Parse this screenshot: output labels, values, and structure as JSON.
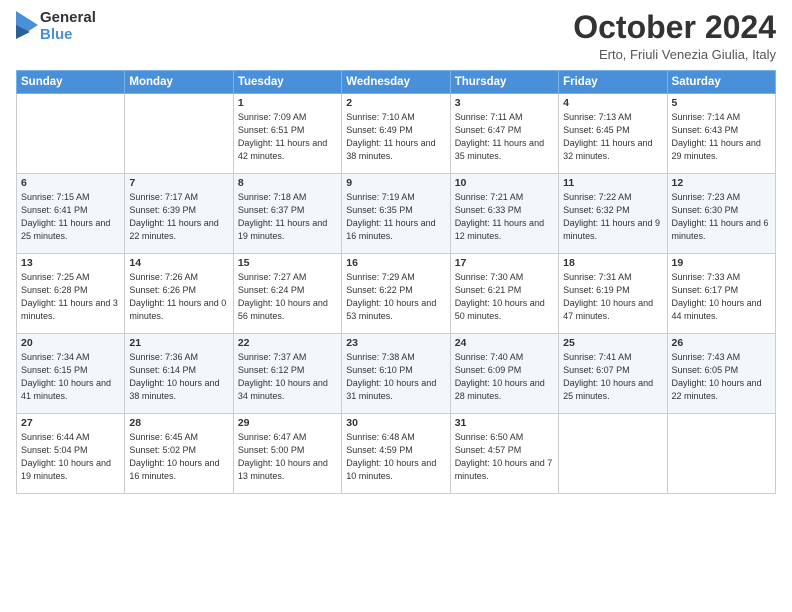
{
  "header": {
    "logo_general": "General",
    "logo_blue": "Blue",
    "month_title": "October 2024",
    "location": "Erto, Friuli Venezia Giulia, Italy"
  },
  "days_of_week": [
    "Sunday",
    "Monday",
    "Tuesday",
    "Wednesday",
    "Thursday",
    "Friday",
    "Saturday"
  ],
  "weeks": [
    [
      {
        "day": "",
        "sunrise": "",
        "sunset": "",
        "daylight": ""
      },
      {
        "day": "",
        "sunrise": "",
        "sunset": "",
        "daylight": ""
      },
      {
        "day": "1",
        "sunrise": "Sunrise: 7:09 AM",
        "sunset": "Sunset: 6:51 PM",
        "daylight": "Daylight: 11 hours and 42 minutes."
      },
      {
        "day": "2",
        "sunrise": "Sunrise: 7:10 AM",
        "sunset": "Sunset: 6:49 PM",
        "daylight": "Daylight: 11 hours and 38 minutes."
      },
      {
        "day": "3",
        "sunrise": "Sunrise: 7:11 AM",
        "sunset": "Sunset: 6:47 PM",
        "daylight": "Daylight: 11 hours and 35 minutes."
      },
      {
        "day": "4",
        "sunrise": "Sunrise: 7:13 AM",
        "sunset": "Sunset: 6:45 PM",
        "daylight": "Daylight: 11 hours and 32 minutes."
      },
      {
        "day": "5",
        "sunrise": "Sunrise: 7:14 AM",
        "sunset": "Sunset: 6:43 PM",
        "daylight": "Daylight: 11 hours and 29 minutes."
      }
    ],
    [
      {
        "day": "6",
        "sunrise": "Sunrise: 7:15 AM",
        "sunset": "Sunset: 6:41 PM",
        "daylight": "Daylight: 11 hours and 25 minutes."
      },
      {
        "day": "7",
        "sunrise": "Sunrise: 7:17 AM",
        "sunset": "Sunset: 6:39 PM",
        "daylight": "Daylight: 11 hours and 22 minutes."
      },
      {
        "day": "8",
        "sunrise": "Sunrise: 7:18 AM",
        "sunset": "Sunset: 6:37 PM",
        "daylight": "Daylight: 11 hours and 19 minutes."
      },
      {
        "day": "9",
        "sunrise": "Sunrise: 7:19 AM",
        "sunset": "Sunset: 6:35 PM",
        "daylight": "Daylight: 11 hours and 16 minutes."
      },
      {
        "day": "10",
        "sunrise": "Sunrise: 7:21 AM",
        "sunset": "Sunset: 6:33 PM",
        "daylight": "Daylight: 11 hours and 12 minutes."
      },
      {
        "day": "11",
        "sunrise": "Sunrise: 7:22 AM",
        "sunset": "Sunset: 6:32 PM",
        "daylight": "Daylight: 11 hours and 9 minutes."
      },
      {
        "day": "12",
        "sunrise": "Sunrise: 7:23 AM",
        "sunset": "Sunset: 6:30 PM",
        "daylight": "Daylight: 11 hours and 6 minutes."
      }
    ],
    [
      {
        "day": "13",
        "sunrise": "Sunrise: 7:25 AM",
        "sunset": "Sunset: 6:28 PM",
        "daylight": "Daylight: 11 hours and 3 minutes."
      },
      {
        "day": "14",
        "sunrise": "Sunrise: 7:26 AM",
        "sunset": "Sunset: 6:26 PM",
        "daylight": "Daylight: 11 hours and 0 minutes."
      },
      {
        "day": "15",
        "sunrise": "Sunrise: 7:27 AM",
        "sunset": "Sunset: 6:24 PM",
        "daylight": "Daylight: 10 hours and 56 minutes."
      },
      {
        "day": "16",
        "sunrise": "Sunrise: 7:29 AM",
        "sunset": "Sunset: 6:22 PM",
        "daylight": "Daylight: 10 hours and 53 minutes."
      },
      {
        "day": "17",
        "sunrise": "Sunrise: 7:30 AM",
        "sunset": "Sunset: 6:21 PM",
        "daylight": "Daylight: 10 hours and 50 minutes."
      },
      {
        "day": "18",
        "sunrise": "Sunrise: 7:31 AM",
        "sunset": "Sunset: 6:19 PM",
        "daylight": "Daylight: 10 hours and 47 minutes."
      },
      {
        "day": "19",
        "sunrise": "Sunrise: 7:33 AM",
        "sunset": "Sunset: 6:17 PM",
        "daylight": "Daylight: 10 hours and 44 minutes."
      }
    ],
    [
      {
        "day": "20",
        "sunrise": "Sunrise: 7:34 AM",
        "sunset": "Sunset: 6:15 PM",
        "daylight": "Daylight: 10 hours and 41 minutes."
      },
      {
        "day": "21",
        "sunrise": "Sunrise: 7:36 AM",
        "sunset": "Sunset: 6:14 PM",
        "daylight": "Daylight: 10 hours and 38 minutes."
      },
      {
        "day": "22",
        "sunrise": "Sunrise: 7:37 AM",
        "sunset": "Sunset: 6:12 PM",
        "daylight": "Daylight: 10 hours and 34 minutes."
      },
      {
        "day": "23",
        "sunrise": "Sunrise: 7:38 AM",
        "sunset": "Sunset: 6:10 PM",
        "daylight": "Daylight: 10 hours and 31 minutes."
      },
      {
        "day": "24",
        "sunrise": "Sunrise: 7:40 AM",
        "sunset": "Sunset: 6:09 PM",
        "daylight": "Daylight: 10 hours and 28 minutes."
      },
      {
        "day": "25",
        "sunrise": "Sunrise: 7:41 AM",
        "sunset": "Sunset: 6:07 PM",
        "daylight": "Daylight: 10 hours and 25 minutes."
      },
      {
        "day": "26",
        "sunrise": "Sunrise: 7:43 AM",
        "sunset": "Sunset: 6:05 PM",
        "daylight": "Daylight: 10 hours and 22 minutes."
      }
    ],
    [
      {
        "day": "27",
        "sunrise": "Sunrise: 6:44 AM",
        "sunset": "Sunset: 5:04 PM",
        "daylight": "Daylight: 10 hours and 19 minutes."
      },
      {
        "day": "28",
        "sunrise": "Sunrise: 6:45 AM",
        "sunset": "Sunset: 5:02 PM",
        "daylight": "Daylight: 10 hours and 16 minutes."
      },
      {
        "day": "29",
        "sunrise": "Sunrise: 6:47 AM",
        "sunset": "Sunset: 5:00 PM",
        "daylight": "Daylight: 10 hours and 13 minutes."
      },
      {
        "day": "30",
        "sunrise": "Sunrise: 6:48 AM",
        "sunset": "Sunset: 4:59 PM",
        "daylight": "Daylight: 10 hours and 10 minutes."
      },
      {
        "day": "31",
        "sunrise": "Sunrise: 6:50 AM",
        "sunset": "Sunset: 4:57 PM",
        "daylight": "Daylight: 10 hours and 7 minutes."
      },
      {
        "day": "",
        "sunrise": "",
        "sunset": "",
        "daylight": ""
      },
      {
        "day": "",
        "sunrise": "",
        "sunset": "",
        "daylight": ""
      }
    ]
  ]
}
